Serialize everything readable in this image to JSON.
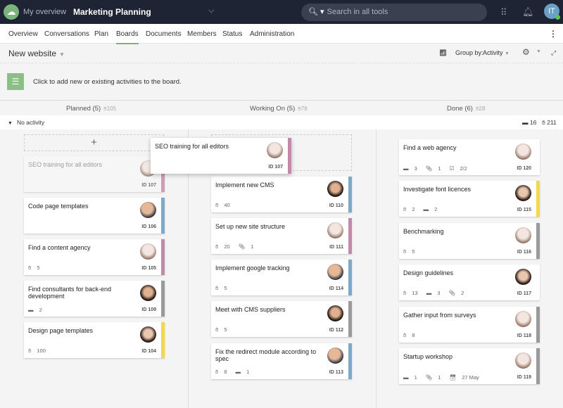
{
  "topbar": {
    "my_overview": "My overview",
    "project": "Marketing Planning",
    "search_placeholder": "Search in all tools",
    "user_initials": "IT"
  },
  "nav": {
    "items": [
      "Overview",
      "Conversations",
      "Plan",
      "Boards",
      "Documents",
      "Members",
      "Status",
      "Administration"
    ],
    "active": "Boards"
  },
  "toolbar": {
    "board_name": "New website",
    "group_by_label": "Group by:",
    "group_by_value": "Activity"
  },
  "banner": {
    "text": "Click to add new or existing activities to the board."
  },
  "columns": [
    {
      "title": "Planned (5)",
      "likes": "105"
    },
    {
      "title": "Working On (5)",
      "likes": "78"
    },
    {
      "title": "Done (6)",
      "likes": "28"
    }
  ],
  "swimlane": {
    "label": "No activity",
    "cards": "16",
    "likes": "211"
  },
  "colors": {
    "pink": "#c08aa8",
    "blue": "#7fa9c9",
    "gray": "#9a9a9a",
    "yellow": "#f5d84a",
    "accent": "#7ab47c"
  },
  "dragged_card": {
    "title": "SEO training for all editors",
    "id": "ID 107",
    "stripe": "pink",
    "avatar": "woman-light"
  },
  "cards": {
    "planned": [
      {
        "title": "SEO training for all editors",
        "id": "ID 107",
        "stripe": "pink",
        "avatar": "woman-light",
        "badges": [],
        "ghost": true
      },
      {
        "title": "Code page templates",
        "id": "ID 106",
        "stripe": "blue",
        "avatar": "man-bald",
        "badges": []
      },
      {
        "title": "Find a content agency",
        "id": "ID 105",
        "stripe": "pink",
        "avatar": "woman-light",
        "badges": [
          {
            "icon": "like",
            "value": "5"
          }
        ]
      },
      {
        "title": "Find consultants for back-end development",
        "id": "ID 109",
        "stripe": "gray",
        "avatar": "man-beard",
        "badges": [
          {
            "icon": "comment",
            "value": "2"
          }
        ]
      },
      {
        "title": "Design page templates",
        "id": "ID 104",
        "stripe": "yellow",
        "avatar": "woman-dark",
        "badges": [
          {
            "icon": "like",
            "value": "100"
          }
        ]
      }
    ],
    "working": [
      {
        "title": "Implement new CMS",
        "id": "ID 110",
        "stripe": "blue",
        "avatar": "man-beard",
        "badges": [
          {
            "icon": "like",
            "value": "40"
          }
        ]
      },
      {
        "title": "Set up new site structure",
        "id": "ID 111",
        "stripe": "pink",
        "avatar": "woman-light",
        "badges": [
          {
            "icon": "like",
            "value": "20"
          },
          {
            "icon": "attachment",
            "value": "1"
          }
        ]
      },
      {
        "title": "Implement google tracking",
        "id": "ID 114",
        "stripe": "blue",
        "avatar": "man-bald",
        "badges": [
          {
            "icon": "like",
            "value": "5"
          }
        ]
      },
      {
        "title": "Meet with CMS suppliers",
        "id": "ID 112",
        "stripe": "gray",
        "avatar": "man-beard",
        "badges": [
          {
            "icon": "like",
            "value": "5"
          }
        ]
      },
      {
        "title": "Fix the redirect module according to spec",
        "id": "ID 113",
        "stripe": "blue",
        "avatar": "man-bald",
        "badges": [
          {
            "icon": "like",
            "value": "8"
          },
          {
            "icon": "comment",
            "value": "1"
          }
        ]
      }
    ],
    "done": [
      {
        "title": "Find a web agency",
        "id": "ID 120",
        "stripe": "",
        "avatar": "woman-light",
        "badges": [
          {
            "icon": "comment",
            "value": "3"
          },
          {
            "icon": "attachment",
            "value": "1"
          },
          {
            "icon": "checklist",
            "value": "2/2"
          }
        ]
      },
      {
        "title": "Investigate font licences",
        "id": "ID 115",
        "stripe": "yellow",
        "avatar": "woman-dark",
        "badges": [
          {
            "icon": "like",
            "value": "2"
          },
          {
            "icon": "comment",
            "value": "2"
          }
        ]
      },
      {
        "title": "Benchmarking",
        "id": "ID 116",
        "stripe": "gray",
        "avatar": "woman-light",
        "badges": [
          {
            "icon": "like",
            "value": "5"
          }
        ]
      },
      {
        "title": "Design guidelines",
        "id": "ID 117",
        "stripe": "",
        "avatar": "woman-dark",
        "badges": [
          {
            "icon": "like",
            "value": "13"
          },
          {
            "icon": "comment",
            "value": "3"
          },
          {
            "icon": "attachment",
            "value": "2"
          }
        ]
      },
      {
        "title": "Gather input from surveys",
        "id": "ID 118",
        "stripe": "gray",
        "avatar": "woman-light",
        "badges": [
          {
            "icon": "like",
            "value": "8"
          }
        ]
      },
      {
        "title": "Startup workshop",
        "id": "ID 119",
        "stripe": "gray",
        "avatar": "woman-light",
        "badges": [
          {
            "icon": "comment",
            "value": "1"
          },
          {
            "icon": "attachment",
            "value": "1"
          },
          {
            "icon": "calendar",
            "value": "27 May"
          }
        ]
      }
    ]
  }
}
